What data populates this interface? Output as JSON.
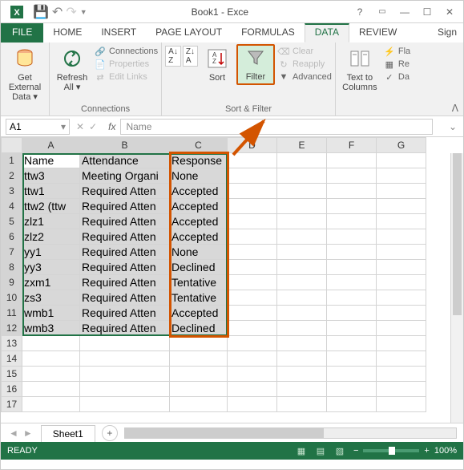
{
  "window": {
    "title": "Book1 - Exce"
  },
  "tabs": {
    "file": "FILE",
    "home": "HOME",
    "insert": "INSERT",
    "pagelayout": "PAGE LAYOUT",
    "formulas": "FORMULAS",
    "data": "DATA",
    "review": "REVIEW",
    "signin": "Sign"
  },
  "ribbon": {
    "getdata": "Get External\nData ▾",
    "refresh": "Refresh\nAll ▾",
    "connections": "Connections",
    "properties": "Properties",
    "editlinks": "Edit Links",
    "connections_group": "Connections",
    "sort": "Sort",
    "filter": "Filter",
    "clear": "Clear",
    "reapply": "Reapply",
    "advanced": "Advanced",
    "sortfilter_group": "Sort & Filter",
    "texttocols": "Text to\nColumns",
    "fla": "Fla",
    "re": "Re",
    "da": "Da"
  },
  "formulabar": {
    "ref": "A1",
    "value": "Name"
  },
  "columns": [
    "A",
    "B",
    "C",
    "D",
    "E",
    "F",
    "G"
  ],
  "rows": [
    {
      "n": "1",
      "a": "Name",
      "b": "Attendance",
      "c": "Response"
    },
    {
      "n": "2",
      "a": "ttw3",
      "b": "Meeting Organi",
      "c": "None"
    },
    {
      "n": "3",
      "a": "ttw1",
      "b": "Required Atten",
      "c": "Accepted"
    },
    {
      "n": "4",
      "a": "ttw2 (ttw",
      "b": "Required Atten",
      "c": "Accepted"
    },
    {
      "n": "5",
      "a": "zlz1",
      "b": "Required Atten",
      "c": "Accepted"
    },
    {
      "n": "6",
      "a": "zlz2",
      "b": "Required Atten",
      "c": "Accepted"
    },
    {
      "n": "7",
      "a": "yy1",
      "b": "Required Atten",
      "c": "None"
    },
    {
      "n": "8",
      "a": "yy3",
      "b": "Required Atten",
      "c": "Declined"
    },
    {
      "n": "9",
      "a": "zxm1",
      "b": "Required Atten",
      "c": "Tentative"
    },
    {
      "n": "10",
      "a": "zs3",
      "b": "Required Atten",
      "c": "Tentative"
    },
    {
      "n": "11",
      "a": "wmb1",
      "b": "Required Atten",
      "c": "Accepted"
    },
    {
      "n": "12",
      "a": "wmb3",
      "b": "Required Atten",
      "c": "Declined"
    }
  ],
  "emptyrows": [
    "13",
    "14",
    "15",
    "16",
    "17"
  ],
  "sheet": {
    "name": "Sheet1"
  },
  "status": {
    "ready": "READY",
    "zoom": "100%"
  }
}
